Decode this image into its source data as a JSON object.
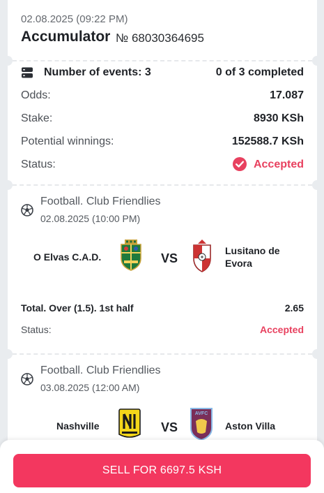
{
  "header": {
    "date": "02.08.2025 (09:22 PM)",
    "title": "Accumulator",
    "ticket_number": "№ 68030364695"
  },
  "summary": {
    "events_label": "Number of events: 3",
    "completed": "0 of 3 completed",
    "odds_label": "Odds:",
    "odds_value": "17.087",
    "stake_label": "Stake:",
    "stake_value": "8930 KSh",
    "winnings_label": "Potential winnings:",
    "winnings_value": "152588.7 KSh",
    "status_label": "Status:",
    "status_value": "Accepted"
  },
  "events": [
    {
      "league": "Football. Club Friendlies",
      "date": "02.08.2025 (10:00 PM)",
      "home_team": "O Elvas C.A.D.",
      "vs": "VS",
      "away_team_line1": "Lusitano de",
      "away_team_line2": "Evora",
      "bet_line": "Total. Over (1.5). 1st half",
      "bet_odds": "2.65",
      "status_label": "Status:",
      "status_value": "Accepted"
    },
    {
      "league": "Football. Club Friendlies",
      "date": "03.08.2025 (12:00 AM)",
      "home_team": "Nashville",
      "vs": "VS",
      "away_team": "Aston Villa",
      "away_crest_text": "AVFC"
    }
  ],
  "footer": {
    "sell_label": "SELL FOR 6697.5 KSH"
  },
  "colors": {
    "accent": "#f3375f",
    "status_accepted": "#e8415f"
  },
  "icons": {
    "events": "list-icon",
    "status": "check-circle-icon",
    "sport": "soccer-ball-icon"
  }
}
